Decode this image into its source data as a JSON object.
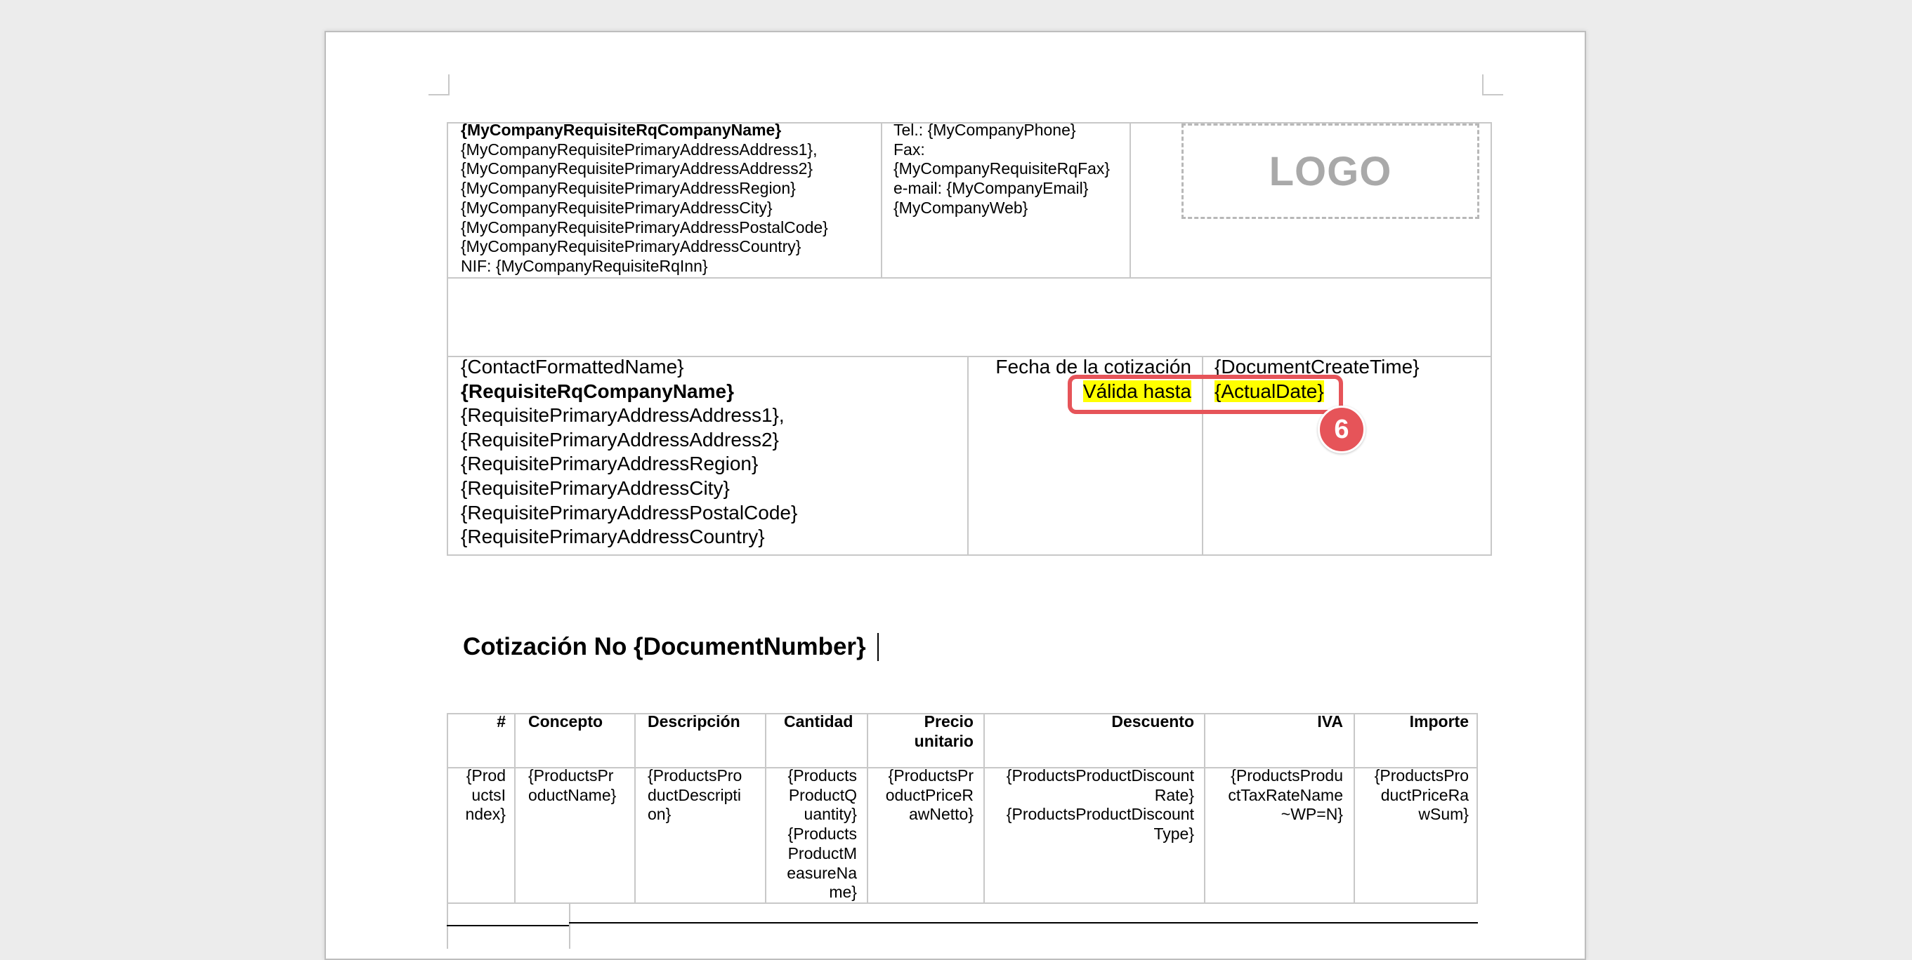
{
  "company": {
    "name": "{MyCompanyRequisiteRqCompanyName}",
    "lines": [
      "{MyCompanyRequisitePrimaryAddressAddress1},",
      "{MyCompanyRequisitePrimaryAddressAddress2}",
      "{MyCompanyRequisitePrimaryAddressRegion}",
      "{MyCompanyRequisitePrimaryAddressCity}",
      "{MyCompanyRequisitePrimaryAddressPostalCode}",
      "{MyCompanyRequisitePrimaryAddressCountry}",
      "NIF: {MyCompanyRequisiteRqInn}"
    ]
  },
  "contact_info": [
    "Tel.: {MyCompanyPhone}",
    "Fax:",
    "{MyCompanyRequisiteRqFax}",
    "e-mail: {MyCompanyEmail}",
    "{MyCompanyWeb}"
  ],
  "logo_text": "LOGO",
  "client": {
    "contact": "{ContactFormattedName}",
    "company": "{RequisiteRqCompanyName}",
    "lines": [
      "{RequisitePrimaryAddressAddress1},",
      "{RequisitePrimaryAddressAddress2}",
      "{RequisitePrimaryAddressRegion}",
      "{RequisitePrimaryAddressCity}",
      "{RequisitePrimaryAddressPostalCode}",
      "{RequisitePrimaryAddressCountry}"
    ]
  },
  "dates": {
    "quote_date_label": "Fecha de la cotización",
    "quote_date_value": "{DocumentCreateTime}",
    "valid_until_label": "Válida hasta",
    "valid_until_value": "{ActualDate}"
  },
  "annotation": {
    "badge": "6",
    "color": "#e65459"
  },
  "title": "Cotización No {DocumentNumber}",
  "products_table": {
    "headers": {
      "index": "#",
      "concept": "Concepto",
      "description": "Descripción",
      "quantity": "Cantidad",
      "price": [
        "Precio",
        "unitario"
      ],
      "discount": "Descuento",
      "tax": "IVA",
      "amount": "Importe"
    },
    "row": {
      "index": [
        "{Prod",
        "uctsI",
        "ndex}"
      ],
      "concept": [
        "{ProductsPr",
        "oductName}"
      ],
      "description": [
        "{ProductsPro",
        "ductDescripti",
        "on}"
      ],
      "quantity": [
        "{Products",
        "ProductQ",
        "uantity}",
        "{Products",
        "ProductM",
        "easureNa",
        "me}"
      ],
      "price": [
        "{ProductsPr",
        "oductPriceR",
        "awNetto}"
      ],
      "discount": [
        "{ProductsProductDiscount",
        "Rate}",
        "{ProductsProductDiscount",
        "Type}"
      ],
      "tax": [
        "{ProductsProdu",
        "ctTaxRateName",
        "~WP=N}"
      ],
      "amount": [
        "{ProductsPro",
        "ductPriceRa",
        "wSum}"
      ]
    }
  },
  "colors": {
    "highlight": "#ffff00",
    "border": "#c8c8c8",
    "background": "#ececec"
  }
}
